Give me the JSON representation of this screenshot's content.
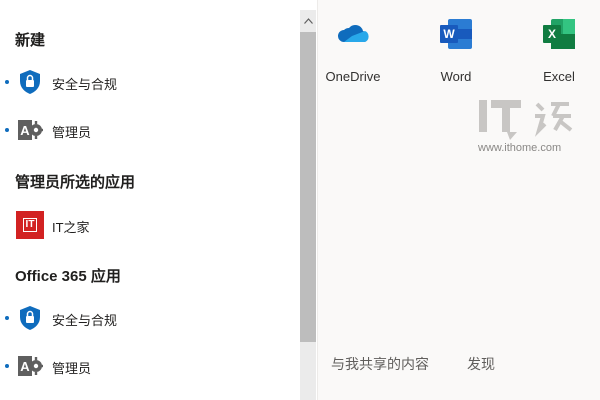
{
  "sections": {
    "new": {
      "title": "新建",
      "items": [
        {
          "label": "安全与合规",
          "icon": "shield-lock-icon"
        },
        {
          "label": "管理员",
          "icon": "admin-gear-icon"
        }
      ]
    },
    "admin_selected": {
      "title": "管理员所选的应用",
      "items": [
        {
          "label": "IT之家",
          "icon": "ithome-logo-icon",
          "icon_text": "IT"
        }
      ]
    },
    "office365": {
      "title": "Office 365 应用",
      "items": [
        {
          "label": "安全与合规",
          "icon": "shield-lock-icon"
        },
        {
          "label": "管理员",
          "icon": "admin-gear-icon"
        }
      ]
    }
  },
  "apps": [
    {
      "label": "OneDrive",
      "icon": "onedrive-icon"
    },
    {
      "label": "Word",
      "icon": "word-icon",
      "icon_text": "W"
    },
    {
      "label": "Excel",
      "icon": "excel-icon",
      "icon_text": "X"
    }
  ],
  "watermark": {
    "url": "www.ithome.com"
  },
  "bottom_nav": {
    "shared_with_me": "与我共享的内容",
    "discover": "发现"
  },
  "colors": {
    "accent_blue": "#0f6cbd",
    "word_blue": "#185abd",
    "excel_green": "#107c41",
    "ithome_red": "#d22222",
    "admin_gray": "#5f5f5f"
  }
}
